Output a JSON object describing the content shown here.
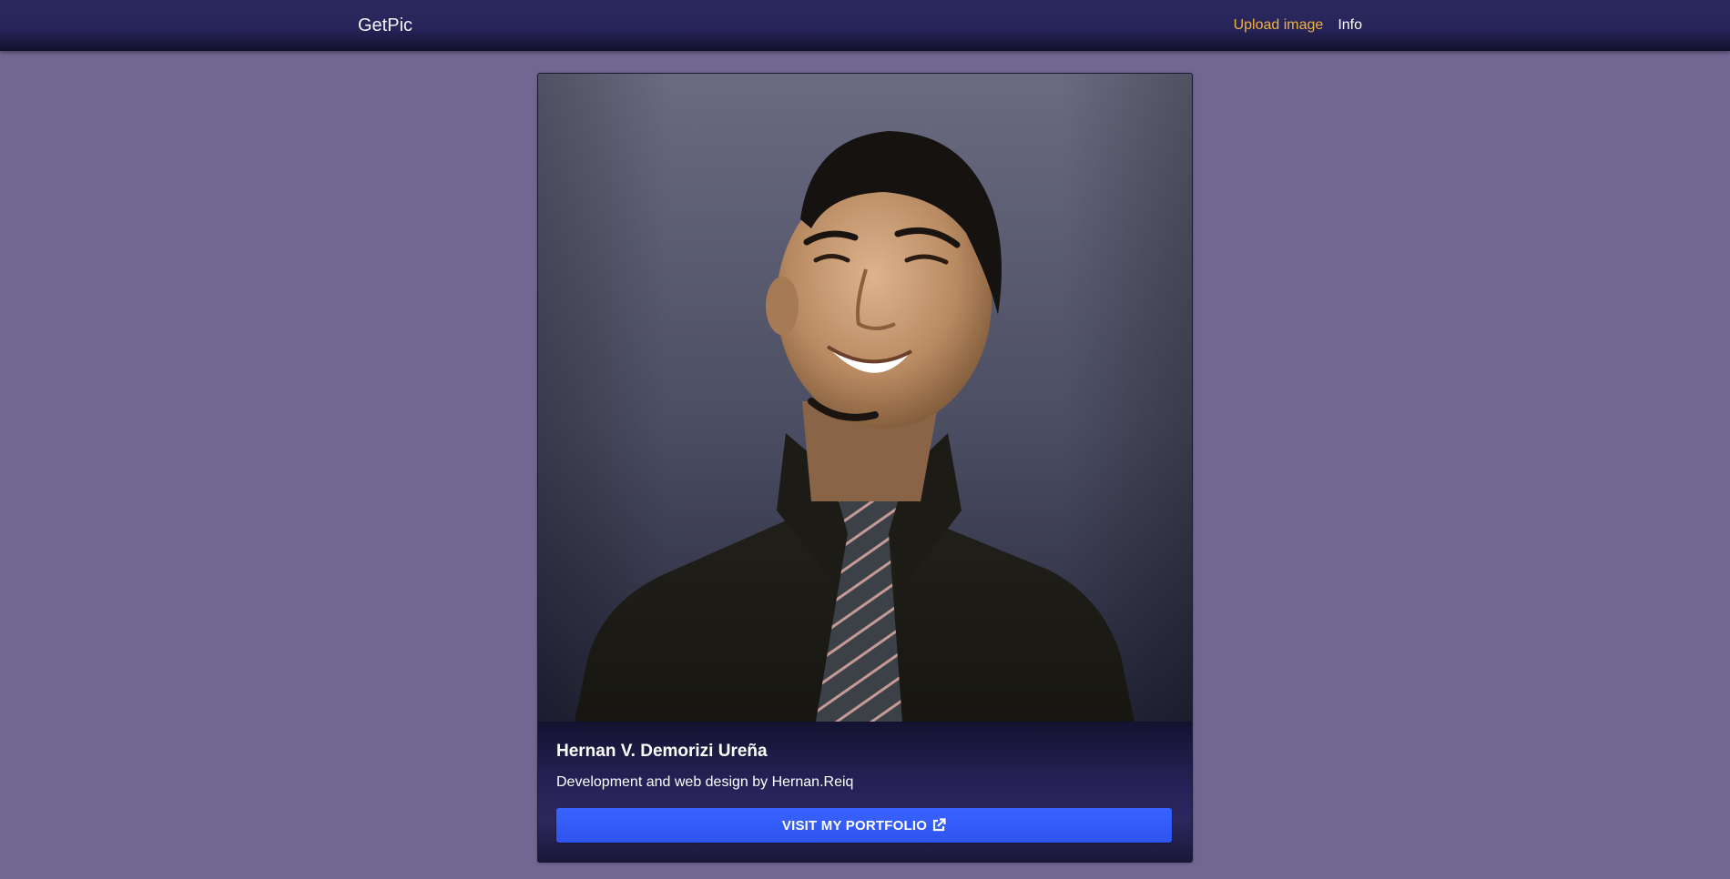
{
  "navbar": {
    "brand": "GetPic",
    "links": [
      {
        "label": "Upload image",
        "active": true
      },
      {
        "label": "Info",
        "active": false
      }
    ]
  },
  "card": {
    "title": "Hernan V. Demorizi Ureña",
    "text": "Development and web design by Hernan.Reiq",
    "button_label": "VISIT MY PORTFOLIO",
    "button_icon": "external-link-icon"
  },
  "colors": {
    "page_background": "#726793",
    "navbar": "#27245a",
    "accent_link": "#f0b33a",
    "button": "#3361fb"
  }
}
